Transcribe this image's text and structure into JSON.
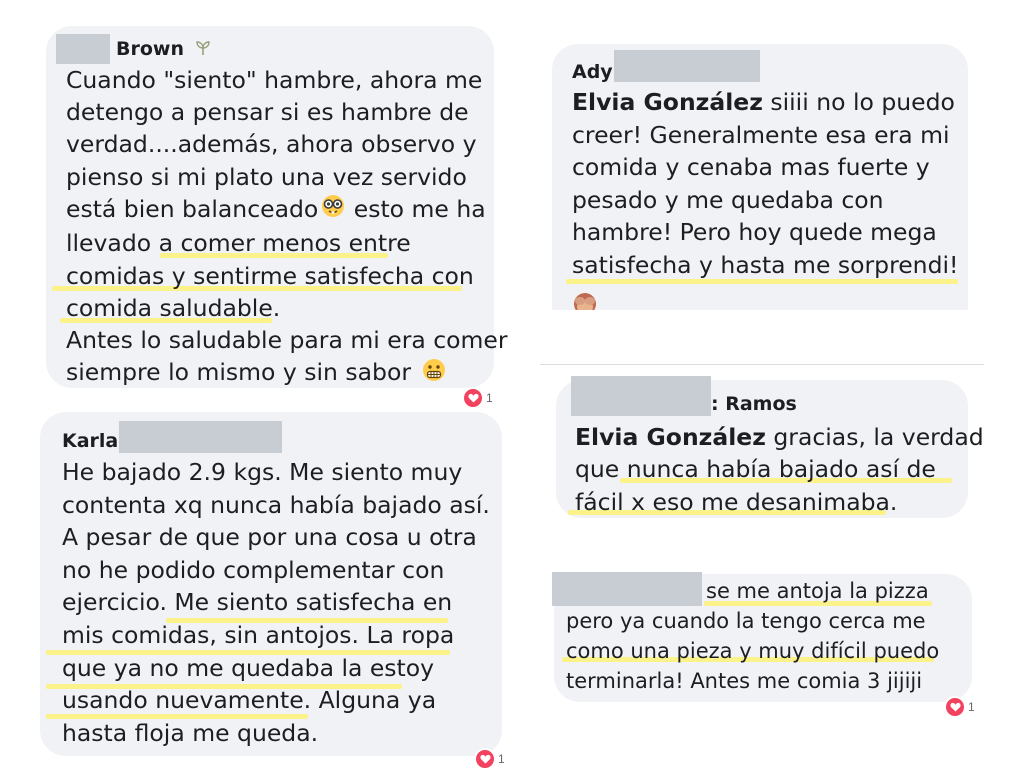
{
  "comments": [
    {
      "author": "Brown",
      "lines": [
        "Cuando \"siento\" hambre, ahora me",
        "detengo a pensar si es hambre de",
        "verdad....además, ahora observo y",
        "pienso si mi plato una vez servido",
        "está bien balanceado",
        "llevado a comer menos entre",
        "comidas y sentirme satisfecha con",
        "comida saludable.",
        "Antes lo saludable para mi era comer",
        "siempre lo mismo y sin sabor"
      ],
      "line5_suffix": " esto me ha",
      "reaction_count": "1"
    },
    {
      "author": "Karla",
      "lines": [
        "He bajado 2.9 kgs. Me siento muy",
        "contenta xq nunca había bajado así.",
        "A pesar de que por una cosa u otra",
        "no he podido complementar con",
        "ejercicio. Me siento satisfecha en",
        "mis comidas, sin antojos. La ropa",
        "que ya no me quedaba la estoy",
        "usando nuevamente. Alguna ya",
        "hasta floja me queda."
      ],
      "reaction_count": "1"
    },
    {
      "author": "Ady",
      "mention": "Elvia González",
      "lines": [
        " siiii no lo puedo",
        "creer! Generalmente esa era mi",
        "comida y cenaba mas fuerte y",
        "pesado y me quedaba con",
        "hambre! Pero hoy quede mega",
        "satisfecha y hasta me sorprendi!"
      ]
    },
    {
      "author": ": Ramos",
      "mention": "Elvia González",
      "lines": [
        " gracias, la verdad",
        "que nunca había bajado así de",
        "fácil x eso me desanimaba."
      ]
    },
    {
      "lines": [
        "se me antoja la pizza",
        "pero ya cuando la tengo cerca me",
        "como una pieza y muy difícil puedo",
        "terminarla! Antes me comia 3 jijiji"
      ],
      "reaction_count": "1"
    }
  ],
  "colors": {
    "bubble": "#f0f2f5",
    "highlight": "#fbf28a",
    "reaction": "#f3425f",
    "redaction": "#c8cdd3"
  },
  "icons": [
    "sprout-icon",
    "nerd-face-emoji",
    "grimacing-face-emoji",
    "see-no-evil-monkey-emoji",
    "heart-reaction-icon"
  ]
}
